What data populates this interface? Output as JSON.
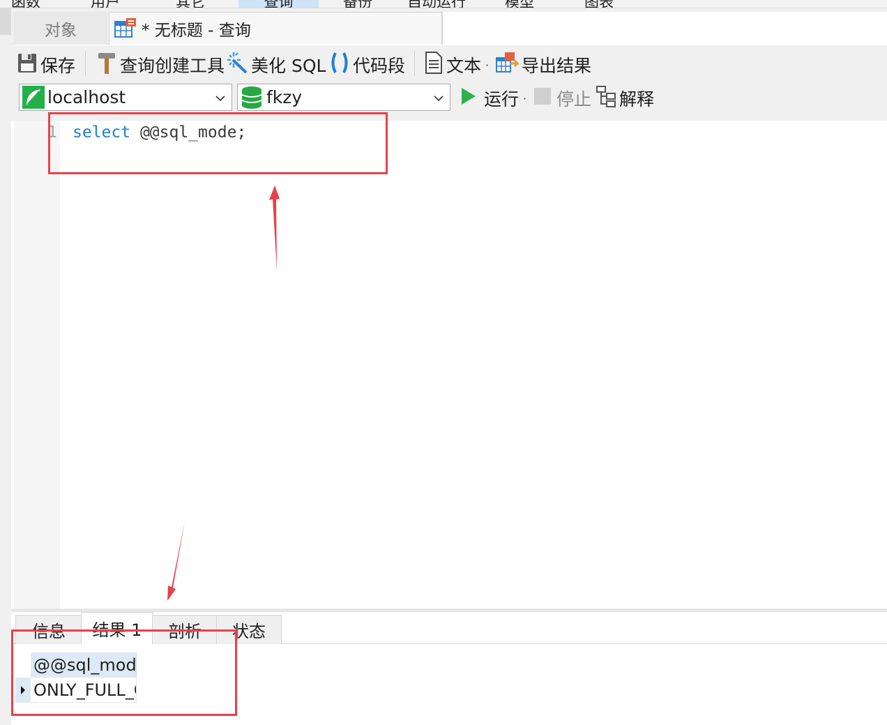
{
  "menu": {
    "items": [
      "函数",
      "用户",
      "其它",
      "查询",
      "备份",
      "自动运行",
      "模型",
      "图表"
    ],
    "active_index": 3
  },
  "tabs": {
    "objects_label": "对象",
    "query_label": "* 无标题 - 查询"
  },
  "toolbar": {
    "save_label": "保存",
    "query_builder_label": "查询创建工具",
    "beautify_sql_label": "美化 SQL",
    "code_snippet_label": "代码段",
    "text_label": "文本",
    "export_label": "导出结果",
    "run_label": "运行",
    "stop_label": "停止",
    "explain_label": "解释",
    "connection": "localhost",
    "database": "fkzy"
  },
  "editor": {
    "line_number": "1",
    "keyword": "select",
    "code_rest": " @@sql_mode;"
  },
  "result_tabs": [
    "信息",
    "结果 1",
    "剖析",
    "状态"
  ],
  "result_active_index": 1,
  "grid": {
    "column_header": "@@sql_mode",
    "cell_value": "ONLY_FULL_GROUP_BY"
  },
  "colors": {
    "annotation_red": "#e8414a",
    "keyword_blue": "#1e7fd6",
    "run_green": "#2fb14a",
    "db_green": "#27a845"
  },
  "icons": [
    "save-icon",
    "hammer-icon",
    "magic-wand-icon",
    "parentheses-icon",
    "text-document-icon",
    "export-icon",
    "play-icon",
    "stop-icon",
    "explain-icon",
    "connection-icon",
    "database-icon",
    "table-icon"
  ]
}
